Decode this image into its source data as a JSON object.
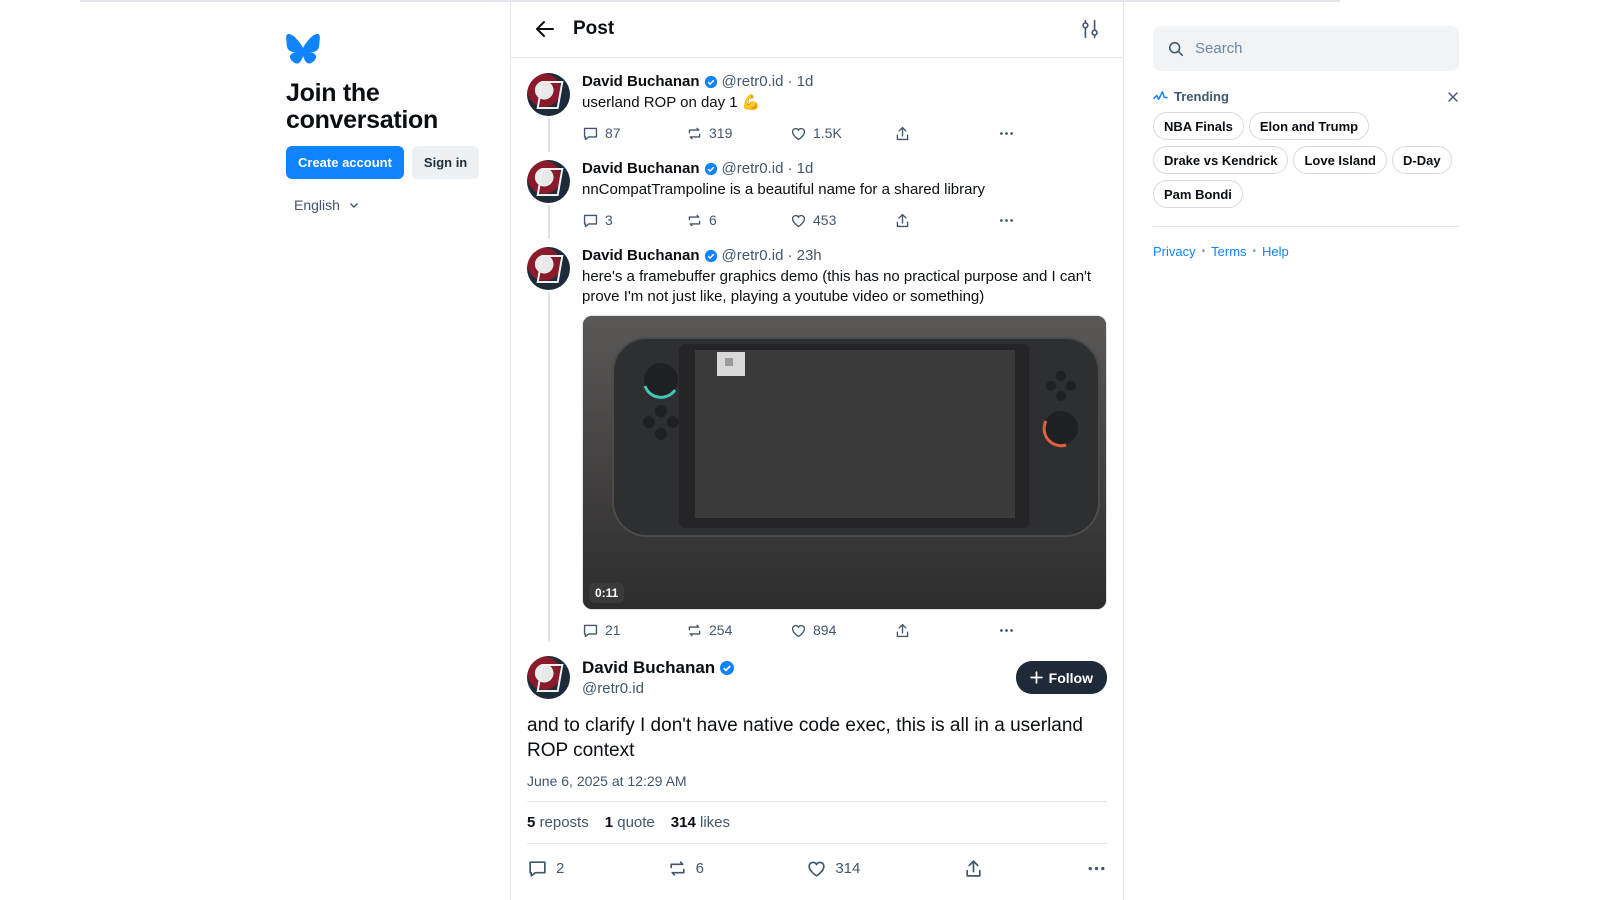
{
  "left": {
    "join_title": "Join the conversation",
    "create_account": "Create account",
    "sign_in": "Sign in",
    "language": "English",
    "brand_color": "#1083fe"
  },
  "header": {
    "title": "Post"
  },
  "thread": [
    {
      "author": "David Buchanan",
      "handle": "@retr0.id",
      "time": "· 1d",
      "text": "userland ROP on day 1 💪",
      "replies": "87",
      "reposts": "319",
      "likes": "1.5K"
    },
    {
      "author": "David Buchanan",
      "handle": "@retr0.id",
      "time": "· 1d",
      "text": "nnCompatTrampoline is a beautiful name for a shared library",
      "replies": "3",
      "reposts": "6",
      "likes": "453"
    },
    {
      "author": "David Buchanan",
      "handle": "@retr0.id",
      "time": "· 23h",
      "text": "here's a framebuffer graphics demo (this has no practical purpose and I can't prove I'm not just like, playing a youtube video or something)",
      "video_duration": "0:11",
      "replies": "21",
      "reposts": "254",
      "likes": "894"
    }
  ],
  "main_post": {
    "author": "David Buchanan",
    "handle": "@retr0.id",
    "follow": "Follow",
    "text": "and to clarify I don't have native code exec, this is all in a userland ROP context",
    "date": "June 6, 2025 at 12:29 AM",
    "reposts_count": "5",
    "reposts_label": "reposts",
    "quotes_count": "1",
    "quotes_label": "quote",
    "likes_count": "314",
    "likes_label": "likes",
    "replies": "2",
    "reposts": "6",
    "likes": "314"
  },
  "right": {
    "search_placeholder": "Search",
    "trending_label": "Trending",
    "topics": [
      "NBA Finals",
      "Elon and Trump",
      "Drake vs Kendrick",
      "Love Island",
      "D-Day",
      "Pam Bondi"
    ],
    "footer": {
      "privacy": "Privacy",
      "terms": "Terms",
      "help": "Help"
    }
  }
}
